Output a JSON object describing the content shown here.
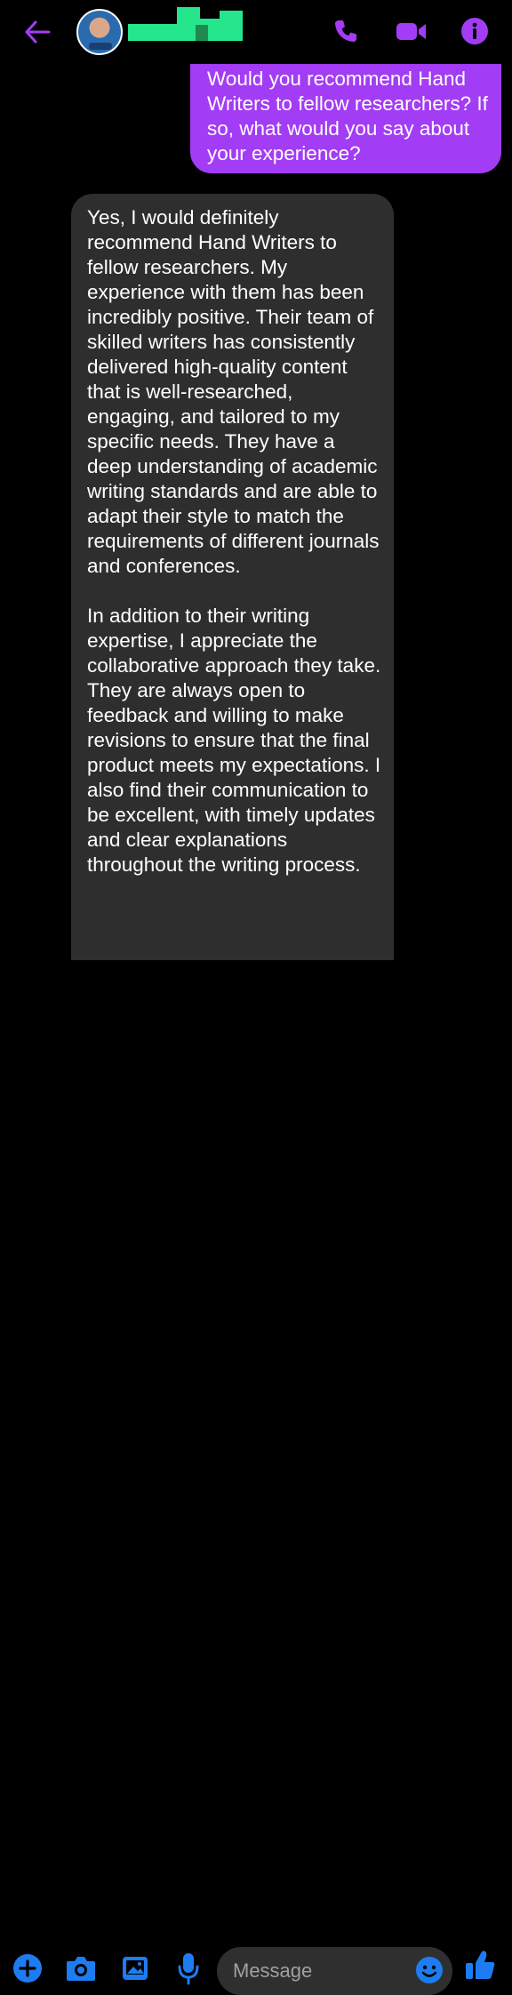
{
  "header": {
    "back_icon": "arrow-left-icon",
    "call_icon": "phone-icon",
    "video_icon": "video-camera-icon",
    "info_icon": "info-icon",
    "accent_color": "#a33cf5"
  },
  "messages": {
    "outgoing": {
      "text": "Would you recommend Hand Writers to fellow researchers? If so, what would you say about your experience?",
      "color": "#a33cf5"
    },
    "incoming": {
      "paragraphs": [
        "Yes, I would definitely recommend Hand Writers to fellow researchers. My experience with them has been incredibly positive. Their team of skilled writers has consistently delivered high-quality content that is well-researched, engaging, and tailored to my specific needs. They have a deep understanding of academic writing standards and are able to adapt their style to match the requirements of different journals and conferences.",
        "In addition to their writing expertise, I appreciate the collaborative approach they take. They are always open to feedback and willing to make revisions to ensure that the final product meets my expectations. I also find their communication to be excellent, with timely updates and clear explanations throughout the writing process."
      ],
      "color": "#2e2e2e"
    }
  },
  "composer": {
    "placeholder": "Message",
    "icons": [
      "plus-icon",
      "camera-icon",
      "gallery-icon",
      "microphone-icon",
      "emoji-icon",
      "thumbs-up-icon"
    ],
    "icon_color": "#1d7cf2"
  }
}
